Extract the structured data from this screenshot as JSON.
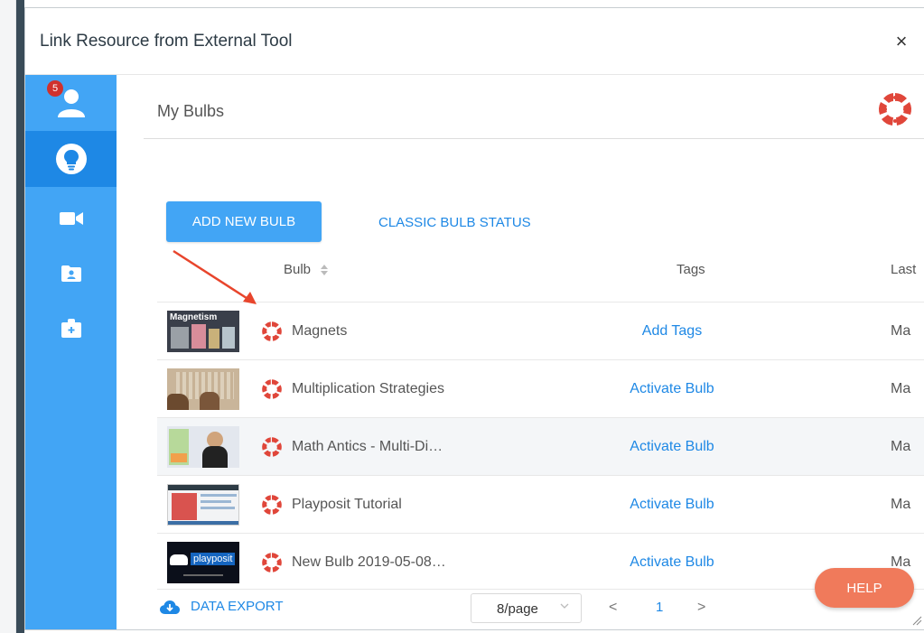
{
  "window": {
    "title": "Link Resource from External Tool",
    "close_label": "×"
  },
  "sidebar": {
    "notification_count": "5",
    "items": [
      {
        "icon": "user-icon",
        "active": false
      },
      {
        "icon": "lightbulb-icon",
        "active": true
      },
      {
        "icon": "video-camera-icon",
        "active": false
      },
      {
        "icon": "folder-user-icon",
        "active": false
      },
      {
        "icon": "briefcase-icon",
        "active": false
      }
    ]
  },
  "header": {
    "title": "My Bulbs",
    "logo": "canvas-logo-icon"
  },
  "actions": {
    "add_label": "ADD NEW BULB",
    "classic_label": "CLASSIC BULB STATUS"
  },
  "table": {
    "columns": {
      "bulb": "Bulb",
      "tags": "Tags",
      "last": "Last"
    },
    "rows": [
      {
        "title": "Magnets",
        "tag": "Add Tags",
        "last": "Ma",
        "thumb_caption": "Magnetism"
      },
      {
        "title": "Multiplication Strategies",
        "tag": "Activate Bulb",
        "last": "Ma"
      },
      {
        "title": "Math Antics - Multi-Di…",
        "tag": "Activate Bulb",
        "last": "Ma"
      },
      {
        "title": "Playposit Tutorial",
        "tag": "Activate Bulb",
        "last": "Ma"
      },
      {
        "title": "New Bulb 2019-05-08…",
        "tag": "Activate Bulb",
        "last": "Ma",
        "thumb_caption": "playposit"
      }
    ]
  },
  "footer": {
    "export_label": "DATA EXPORT",
    "page_size": "8/page",
    "prev": "<",
    "page": "1",
    "next": ">",
    "help_label": "HELP"
  },
  "colors": {
    "accent": "#42a5f5",
    "accent_dark": "#1e88e5",
    "canvas_red": "#e0463a",
    "help": "#f07a5b",
    "annotation": "#e8452c"
  }
}
